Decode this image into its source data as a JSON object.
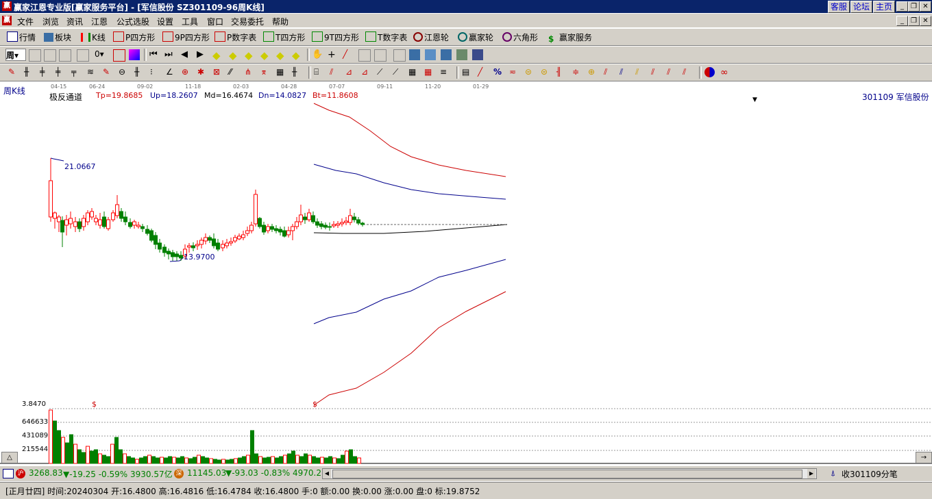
{
  "window": {
    "title": "赢家江恩专业版[赢家服务平台] - [军信股份   SZ301109-96周K线]",
    "logo": "赢",
    "links": [
      "客服",
      "论坛",
      "主页"
    ]
  },
  "menu": [
    "文件",
    "浏览",
    "资讯",
    "江恩",
    "公式选股",
    "设置",
    "工具",
    "窗口",
    "交易委托",
    "帮助"
  ],
  "nav": [
    "行情",
    "板块",
    "K线",
    "P四方形",
    "9P四方形",
    "P数字表",
    "T四方形",
    "9T四方形",
    "T数字表",
    "江恩轮",
    "赢家轮",
    "六角形",
    "赢家服务"
  ],
  "toolbar2": {
    "period_label": "周"
  },
  "chart": {
    "period": "周K线",
    "dates": [
      "04-15",
      "06-24",
      "09-02",
      "11-18",
      "02-03",
      "04-28",
      "07-07",
      "09-11",
      "11-20",
      "01-29"
    ],
    "indicator": {
      "name": "极反通道",
      "tp": "Tp=19.8685",
      "up": "Up=18.2607",
      "md": "Md=16.4674",
      "dn": "Dn=14.0827",
      "bt": "Bt=11.8608"
    },
    "stock_label": "301109  军信股份",
    "high_label": "21.0667",
    "low_label": "13.9700",
    "volume_axis": [
      "3.8470",
      "646633",
      "431089",
      "215544"
    ],
    "dollar_marker": "$"
  },
  "status": {
    "sh_badge": "沪",
    "sh_index": "3268.83",
    "sh_change": "▼-19.25 -0.59% 3930.57亿",
    "sz_badge": "深",
    "sz_index": "11145.03",
    "sz_change": "▼-93.03 -0.83% 4970.2",
    "right_text": "收301109分笔"
  },
  "info": {
    "text": "[正月廿四] 时间:20240304 开:16.4800 高:16.4816 低:16.4784 收:16.4800 手:0 额:0.00 换:0.00 涨:0.00 盘:0 标:19.8752"
  },
  "colors": {
    "titlebar": "#0a246a",
    "up": "#ff0000",
    "down": "#008000",
    "channel_outer": "#cc0000",
    "channel_inner": "#00008b"
  }
}
